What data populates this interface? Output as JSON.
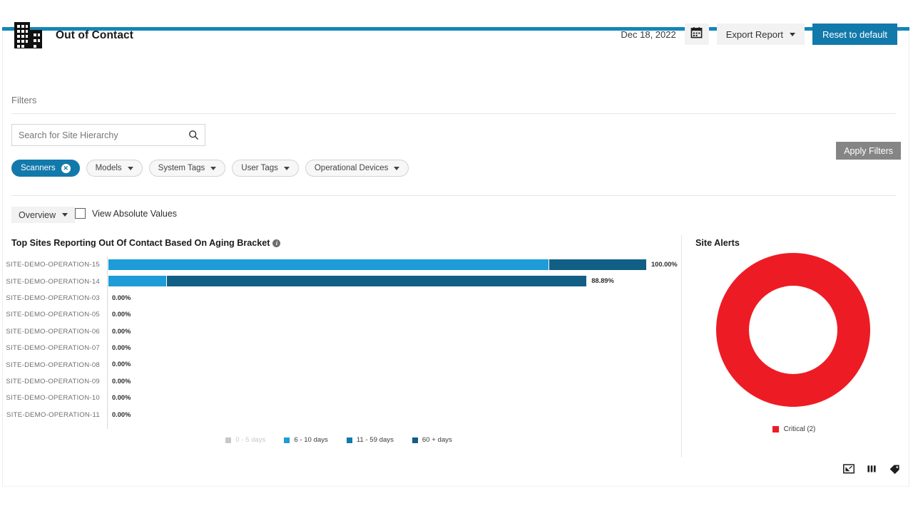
{
  "theme": {
    "accent_blue": "#1279ab",
    "top_bar": "#1386b8",
    "critical_red": "#ed1c24",
    "disabled_gray": "#858585"
  },
  "header": {
    "title": "Out of Contact",
    "building_icon": "building-icon",
    "date": "Dec 18, 2022",
    "calendar_icon": "calendar-icon",
    "export_label": "Export Report",
    "reset_label": "Reset to default"
  },
  "filters": {
    "section_label": "Filters",
    "search": {
      "placeholder": "Search for Site Hierarchy",
      "value": "",
      "icon": "search-icon"
    },
    "chips": [
      {
        "label": "Scanners",
        "active": true,
        "removable": true
      },
      {
        "label": "Models",
        "active": false,
        "removable": false
      },
      {
        "label": "System Tags",
        "active": false,
        "removable": false
      },
      {
        "label": "User Tags",
        "active": false,
        "removable": false
      },
      {
        "label": "Operational Devices",
        "active": false,
        "removable": false
      }
    ],
    "apply_label": "Apply Filters"
  },
  "toolbar": {
    "view_label": "Overview",
    "absolute_values_label": "View Absolute Values",
    "absolute_values_checked": false
  },
  "chart_data": [
    {
      "type": "bar",
      "title": "Top Sites Reporting Out Of Contact Based On Aging Bracket",
      "info_icon": "info-icon",
      "orientation": "horizontal",
      "stacked": true,
      "xlabel": "",
      "ylabel": "",
      "xlim": [
        0,
        100
      ],
      "grid": false,
      "legend_position": "bottom",
      "categories": [
        "SITE-DEMO-OPERATION-15",
        "SITE-DEMO-OPERATION-14",
        "SITE-DEMO-OPERATION-03",
        "SITE-DEMO-OPERATION-05",
        "SITE-DEMO-OPERATION-06",
        "SITE-DEMO-OPERATION-07",
        "SITE-DEMO-OPERATION-08",
        "SITE-DEMO-OPERATION-09",
        "SITE-DEMO-OPERATION-10",
        "SITE-DEMO-OPERATION-11"
      ],
      "totals": [
        "100.00%",
        "88.89%",
        "0.00%",
        "0.00%",
        "0.00%",
        "0.00%",
        "0.00%",
        "0.00%",
        "0.00%",
        "0.00%"
      ],
      "series": [
        {
          "name": "0 - 5 days",
          "color": "#c8c8cb",
          "active": false,
          "values": [
            0,
            0,
            0,
            0,
            0,
            0,
            0,
            0,
            0,
            0
          ]
        },
        {
          "name": "6 - 10 days",
          "color": "#1d9cd7",
          "active": true,
          "values": [
            81.8,
            10.9,
            0,
            0,
            0,
            0,
            0,
            0,
            0,
            0
          ]
        },
        {
          "name": "11 - 59 days",
          "color": "#1279ab",
          "active": true,
          "values": [
            0,
            0,
            0,
            0,
            0,
            0,
            0,
            0,
            0,
            0
          ]
        },
        {
          "name": "60 + days",
          "color": "#125f85",
          "active": true,
          "values": [
            18.2,
            78.0,
            0,
            0,
            0,
            0,
            0,
            0,
            0,
            0
          ]
        }
      ]
    },
    {
      "type": "pie",
      "title": "Site Alerts",
      "donut": true,
      "legend_position": "bottom",
      "labels": [
        "Critical (2)"
      ],
      "values": [
        2
      ],
      "colors": [
        "#ed1c24"
      ]
    }
  ],
  "footer": {
    "icons": [
      "expand-icon",
      "columns-icon",
      "tag-icon"
    ]
  }
}
